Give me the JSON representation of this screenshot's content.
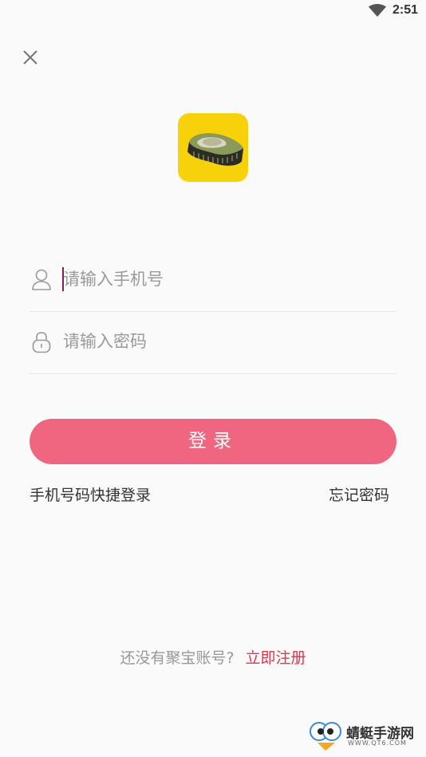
{
  "status_bar": {
    "time": "2:51",
    "wifi_icon": "wifi-icon"
  },
  "close_icon": "close-icon",
  "logo": {
    "icon": "app-logo",
    "background": "#f7d20a"
  },
  "form": {
    "phone": {
      "placeholder": "请输入手机号",
      "value": "",
      "icon": "user-icon"
    },
    "password": {
      "placeholder": "请输入密码",
      "value": "",
      "icon": "lock-icon"
    },
    "login_label": "登录",
    "quick_login_label": "手机号码快捷登录",
    "forgot_label": "忘记密码"
  },
  "signup": {
    "prompt": "还没有聚宝账号?",
    "link": "立即注册"
  },
  "watermark": {
    "title": "蜻蜓手游网",
    "subtitle": "WWW.QT6.COM"
  },
  "colors": {
    "accent": "#f06680",
    "link": "#e8334a",
    "background": "#fafafa"
  }
}
